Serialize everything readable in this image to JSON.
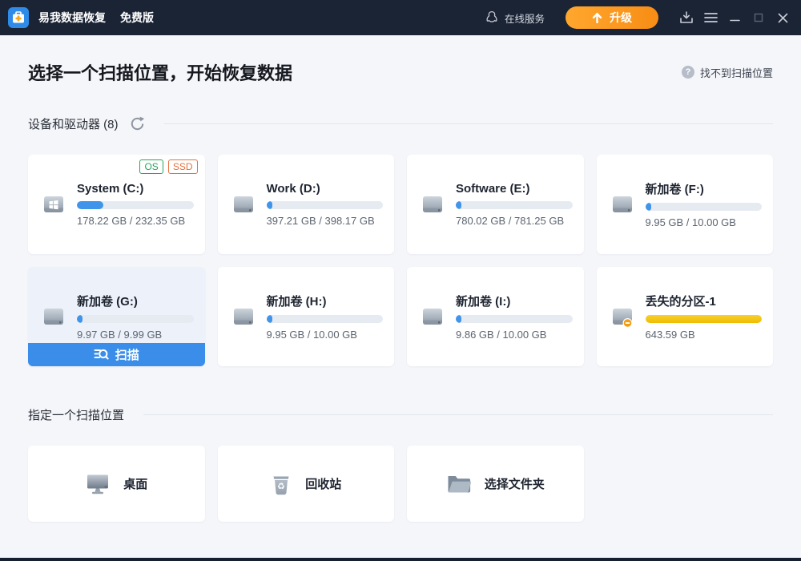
{
  "titlebar": {
    "app_title": "易我数据恢复",
    "edition": "免费版",
    "online_service": "在线服务",
    "upgrade_label": "升级"
  },
  "header": {
    "title": "选择一个扫描位置，开始恢复数据",
    "help_label": "找不到扫描位置",
    "help_glyph": "?"
  },
  "devices_section": {
    "title": "设备和驱动器 (8)"
  },
  "locations_section": {
    "title": "指定一个扫描位置"
  },
  "drives": [
    {
      "name": "System (C:)",
      "size": "178.22 GB / 232.35 GB",
      "used_pct": 23,
      "badges": [
        "OS",
        "SSD"
      ],
      "icon": "windows-drive-icon"
    },
    {
      "name": "Work (D:)",
      "size": "397.21 GB / 398.17 GB",
      "used_pct": 2.5,
      "icon": "drive-icon"
    },
    {
      "name": "Software (E:)",
      "size": "780.02 GB / 781.25 GB",
      "used_pct": 2.5,
      "icon": "drive-icon"
    },
    {
      "name": "新加卷 (F:)",
      "size": "9.95 GB / 10.00 GB",
      "used_pct": 3,
      "icon": "drive-icon"
    },
    {
      "name": "新加卷 (G:)",
      "size": "9.97 GB / 9.99 GB",
      "used_pct": 3,
      "icon": "drive-icon",
      "hovered": true,
      "action_label": "扫描"
    },
    {
      "name": "新加卷 (H:)",
      "size": "9.95 GB / 10.00 GB",
      "used_pct": 3,
      "icon": "drive-icon"
    },
    {
      "name": "新加卷 (I:)",
      "size": "9.86 GB / 10.00 GB",
      "used_pct": 4,
      "icon": "drive-icon"
    },
    {
      "name": "丢失的分区-1",
      "size": "643.59 GB",
      "used_pct": 100,
      "icon": "lost-drive-icon",
      "lost": true
    }
  ],
  "locations": [
    {
      "label": "桌面",
      "icon": "desktop-icon"
    },
    {
      "label": "回收站",
      "icon": "recycle-bin-icon"
    },
    {
      "label": "选择文件夹",
      "icon": "folder-icon"
    }
  ],
  "colors": {
    "titlebar_bg": "#1b2435",
    "accent_blue": "#3a8ee9",
    "progress_blue": "#4094ea",
    "warning_yellow": "#f3c412",
    "upgrade_orange": "#f78d15",
    "os_badge_green": "#27a45c",
    "ssd_badge_orange": "#e4703d"
  }
}
